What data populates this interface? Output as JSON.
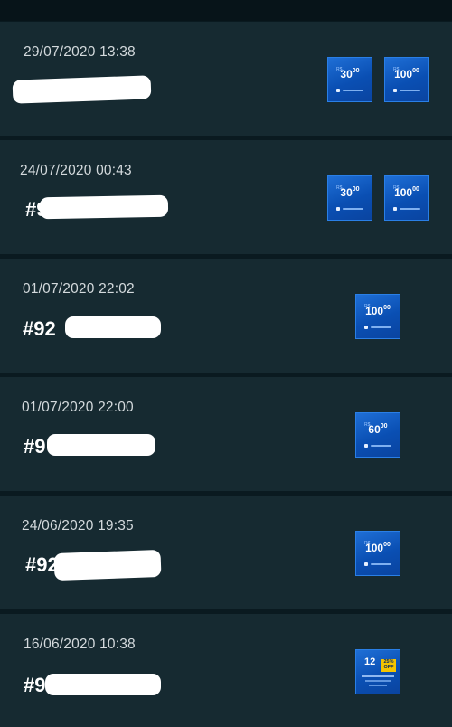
{
  "orders": [
    {
      "date": "29/07/2020 13:38",
      "number": "#",
      "cards": [
        {
          "type": "psn-wallet",
          "currency": "R$",
          "value": "30",
          "cents": "00"
        },
        {
          "type": "psn-wallet",
          "currency": "R$",
          "value": "100",
          "cents": "00"
        }
      ]
    },
    {
      "date": "24/07/2020 00:43",
      "number": "#9",
      "cards": [
        {
          "type": "psn-wallet",
          "currency": "R$",
          "value": "30",
          "cents": "00"
        },
        {
          "type": "psn-wallet",
          "currency": "R$",
          "value": "100",
          "cents": "00"
        }
      ]
    },
    {
      "date": "01/07/2020 22:02",
      "number": "#92",
      "cards": [
        {
          "type": "psn-wallet",
          "currency": "R$",
          "value": "100",
          "cents": "00"
        }
      ]
    },
    {
      "date": "01/07/2020 22:00",
      "number": "#9",
      "cards": [
        {
          "type": "psn-wallet",
          "currency": "R$",
          "value": "60",
          "cents": "00"
        }
      ]
    },
    {
      "date": "24/06/2020 19:35",
      "number": "#92",
      "cards": [
        {
          "type": "psn-wallet",
          "currency": "R$",
          "value": "100",
          "cents": "00"
        }
      ]
    },
    {
      "date": "16/06/2020 10:38",
      "number": "#9",
      "cards": [
        {
          "type": "ps-plus",
          "months": "12",
          "badge": "25% OFF"
        }
      ]
    }
  ]
}
